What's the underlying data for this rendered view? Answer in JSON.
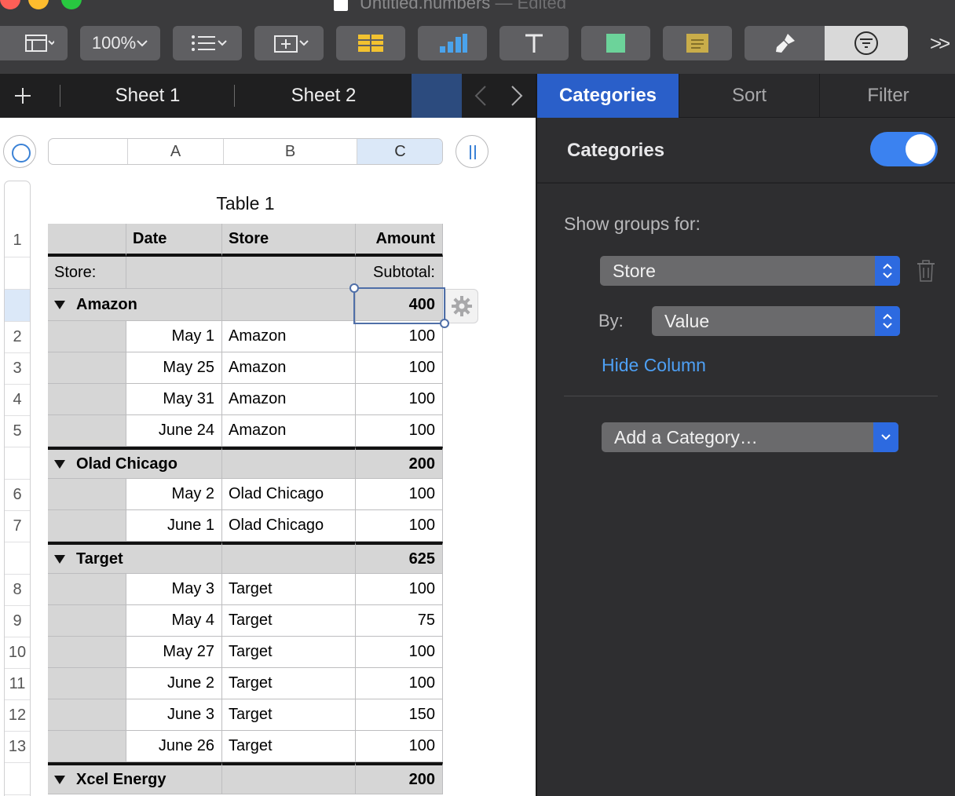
{
  "window": {
    "title": "Untitled.numbers",
    "status": "— Edited",
    "zoom": "100%"
  },
  "colors": {
    "accent": "#2a5fc9",
    "toggle_on": "#3b82f0",
    "link": "#4ea0f5",
    "selection": "#dbe8f8"
  },
  "toolbar": {
    "items": [
      "view-icon",
      "zoom-popup",
      "insert-icon",
      "table-icon",
      "chart-icon",
      "text-icon",
      "shape-icon",
      "comment-icon",
      "format-icon",
      "organize-icon",
      "more-icon"
    ]
  },
  "sheets": {
    "tabs": [
      {
        "label": "Sheet 1"
      },
      {
        "label": "Sheet 2"
      }
    ]
  },
  "columns": {
    "headers": [
      "A",
      "B",
      "C"
    ]
  },
  "table": {
    "title": "Table 1",
    "header": {
      "a": "",
      "date": "Date",
      "store": "Store",
      "amount": "Amount"
    },
    "summary_label": "Store:",
    "subtotal_label": "Subtotal:",
    "groups": [
      {
        "name": "Amazon",
        "subtotal": "400",
        "rows": [
          {
            "num": "2",
            "date": "May 1",
            "store": "Amazon",
            "amount": "100"
          },
          {
            "num": "3",
            "date": "May 25",
            "store": "Amazon",
            "amount": "100"
          },
          {
            "num": "4",
            "date": "May 31",
            "store": "Amazon",
            "amount": "100"
          },
          {
            "num": "5",
            "date": "June 24",
            "store": "Amazon",
            "amount": "100"
          }
        ]
      },
      {
        "name": "Olad Chicago",
        "subtotal": "200",
        "rows": [
          {
            "num": "6",
            "date": "May 2",
            "store": "Olad Chicago",
            "amount": "100"
          },
          {
            "num": "7",
            "date": "June 1",
            "store": "Olad Chicago",
            "amount": "100"
          }
        ]
      },
      {
        "name": "Target",
        "subtotal": "625",
        "rows": [
          {
            "num": "8",
            "date": "May 3",
            "store": "Target",
            "amount": "100"
          },
          {
            "num": "9",
            "date": "May 4",
            "store": "Target",
            "amount": "75"
          },
          {
            "num": "10",
            "date": "May 27",
            "store": "Target",
            "amount": "100"
          },
          {
            "num": "11",
            "date": "June 2",
            "store": "Target",
            "amount": "100"
          },
          {
            "num": "12",
            "date": "June 3",
            "store": "Target",
            "amount": "150"
          },
          {
            "num": "13",
            "date": "June 26",
            "store": "Target",
            "amount": "100"
          }
        ]
      },
      {
        "name": "Xcel Energy",
        "subtotal": "200",
        "rows": []
      }
    ],
    "header_row_num": "1"
  },
  "panel": {
    "tabs": [
      {
        "label": "Categories",
        "active": true
      },
      {
        "label": "Sort",
        "active": false
      },
      {
        "label": "Filter",
        "active": false
      }
    ],
    "categories_title": "Categories",
    "toggle_on": true,
    "show_groups_label": "Show groups for:",
    "group_by_value": "Store",
    "by_label": "By:",
    "by_value": "Value",
    "hide_column": "Hide Column",
    "add_category": "Add a Category…"
  }
}
